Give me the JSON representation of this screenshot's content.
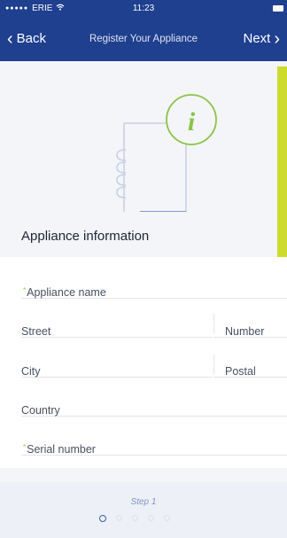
{
  "status_bar": {
    "carrier": "ERIE",
    "time": "11:23"
  },
  "nav": {
    "back_label": "Back",
    "title": "Register Your Appliance",
    "next_label": "Next"
  },
  "section": {
    "title": "Appliance information"
  },
  "form": {
    "appliance_name_placeholder": "Appliance name",
    "street_placeholder": "Street",
    "number_placeholder": "Number",
    "city_placeholder": "City",
    "postal_placeholder": "Postal",
    "country_placeholder": "Country",
    "serial_number_placeholder": "Serial number"
  },
  "footer": {
    "step_label": "Step 1",
    "steps_total": 5,
    "current_step": 1
  },
  "colors": {
    "header": "#1f3f8f",
    "accent_green": "#8bc34a",
    "accent_yellow": "#cddc2c"
  },
  "icons": [
    "back-chevron-icon",
    "next-chevron-icon",
    "info-icon",
    "notebook-icon",
    "wifi-icon",
    "battery-icon"
  ]
}
